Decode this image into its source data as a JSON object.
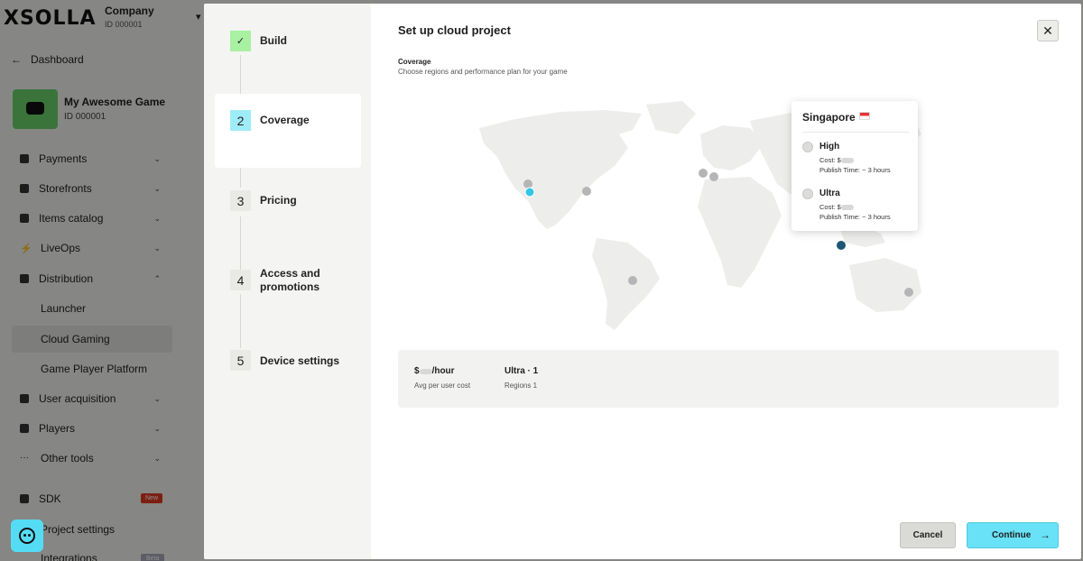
{
  "app": {
    "logo": "XSOLLA",
    "company": {
      "name": "Company",
      "id": "ID 000001"
    },
    "back_label": "Dashboard",
    "project": {
      "name": "My Awesome Game",
      "id": "ID 000001"
    },
    "nav": [
      {
        "label": "Payments",
        "icon": "payments-icon"
      },
      {
        "label": "Storefronts",
        "icon": "storefront-icon"
      },
      {
        "label": "Items catalog",
        "icon": "catalog-icon"
      },
      {
        "label": "LiveOps",
        "icon": "bolt-icon"
      },
      {
        "label": "Distribution",
        "icon": "distribution-icon"
      }
    ],
    "distribution_sub": [
      "Launcher",
      "Cloud Gaming",
      "Game Player Platform"
    ],
    "nav2": [
      {
        "label": "User acquisition",
        "icon": "megaphone-icon"
      },
      {
        "label": "Players",
        "icon": "players-icon"
      },
      {
        "label": "Other tools",
        "icon": "more-icon"
      }
    ],
    "sdk_label": "SDK",
    "sdk_badge": "New",
    "settings_label": "Project settings",
    "integrations_label": "Integrations",
    "integrations_badge": "Beta"
  },
  "modal": {
    "title": "Set up cloud project",
    "close_icon": "close-icon",
    "steps": [
      {
        "num": "",
        "label": "Build",
        "state": "done"
      },
      {
        "num": "2",
        "label": "Coverage",
        "state": "active"
      },
      {
        "num": "3",
        "label": "Pricing",
        "state": "pending"
      },
      {
        "num": "4",
        "label": "Access and promotions",
        "state": "pending"
      },
      {
        "num": "5",
        "label": "Device settings",
        "state": "pending"
      }
    ],
    "coverage": {
      "label": "Coverage",
      "description": "Choose regions and performance plan for your game"
    },
    "popup": {
      "region": "Singapore",
      "options": [
        {
          "name": "High",
          "cost_prefix": "Cost: $",
          "publish_time": "Publish Time: ~ 3 hours"
        },
        {
          "name": "Ultra",
          "cost_prefix": "Cost: $",
          "publish_time": "Publish Time: ~ 3 hours"
        }
      ]
    },
    "summary": {
      "cost_prefix": "$",
      "cost_suffix": "/hour",
      "cost_label": "Avg per user cost",
      "plan": "Ultra · 1",
      "regions": "Regions 1"
    },
    "buttons": {
      "cancel": "Cancel",
      "continue": "Continue"
    },
    "colors": {
      "accent": "#69e2f7",
      "done_step": "#a8f0a2",
      "selected_region": "#1d5775",
      "hover_region": "#33c6e6"
    }
  }
}
